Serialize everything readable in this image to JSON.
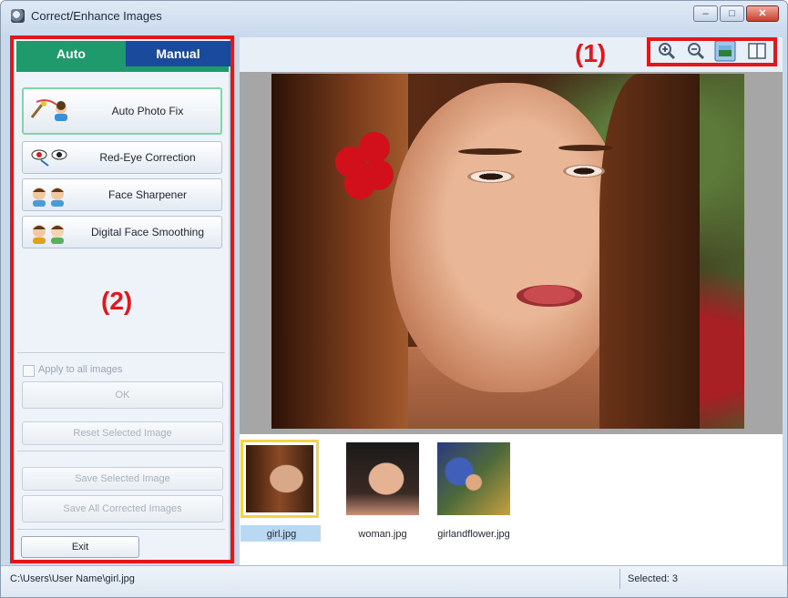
{
  "window": {
    "title": "Correct/Enhance Images",
    "controls": [
      "minimize",
      "maximize",
      "close"
    ]
  },
  "tabs": [
    {
      "label": "Auto",
      "active": true
    },
    {
      "label": "Manual",
      "active": false
    }
  ],
  "features": [
    {
      "label": "Auto Photo Fix",
      "icon": "auto-photo-fix-icon",
      "active": true
    },
    {
      "label": "Red-Eye Correction",
      "icon": "red-eye-icon",
      "active": false
    },
    {
      "label": "Face Sharpener",
      "icon": "face-sharpener-icon",
      "active": false
    },
    {
      "label": "Digital Face Smoothing",
      "icon": "face-smoothing-icon",
      "active": false
    }
  ],
  "callouts": {
    "panel": "(2)",
    "toolbar": "(1)"
  },
  "options": {
    "apply_all_label": "Apply to all images",
    "apply_all_checked": false
  },
  "buttons": {
    "ok": "OK",
    "reset": "Reset Selected Image",
    "save_selected": "Save Selected Image",
    "save_all": "Save All Corrected Images",
    "exit": "Exit"
  },
  "toolbar": [
    "zoom-in-icon",
    "zoom-out-icon",
    "full-image-view-icon",
    "compare-view-icon"
  ],
  "thumbnails": [
    {
      "label": "girl.jpg",
      "selected": true
    },
    {
      "label": "woman.jpg",
      "selected": false
    },
    {
      "label": "girlandflower.jpg",
      "selected": false
    }
  ],
  "status": {
    "path": "C:\\Users\\User Name\\girl.jpg",
    "selected": "Selected: 3"
  },
  "colors": {
    "auto_tab": "#1f9a6c",
    "manual_tab": "#1a4a9c",
    "callout": "#e3161c",
    "selection": "#f0d44a"
  }
}
